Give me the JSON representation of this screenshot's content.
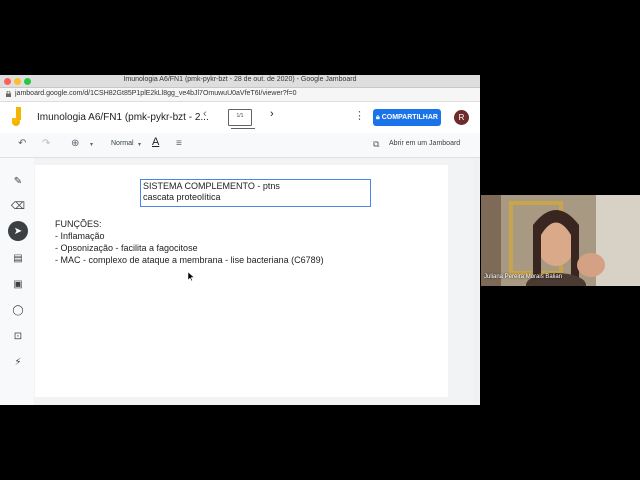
{
  "window": {
    "title": "Imunologia A6/FN1 (pmk-pykr-bzt - 28 de out. de 2020) - Google Jamboard",
    "url": "jamboard.google.com/d/1CSH82Gt85P1plE2kLl8gg_ve4bJl7OmuwuU0aVfeT6I/viewer?f=0"
  },
  "appbar": {
    "doc_title": "Imunologia A6/FN1 (pmk-pykr-bzt - 2...",
    "frame_indicator": "1/1",
    "share_label": "COMPARTILHAR",
    "avatar_initial": "R"
  },
  "toolbar": {
    "zoom_label": "Normal",
    "text_style_glyph": "A",
    "open_in_jamboard": "Abrir em um Jamboard"
  },
  "canvas": {
    "box_line1": "SISTEMA COMPLEMENTO - ptns",
    "box_line2": "cascata proteolítica",
    "lines": [
      "FUNÇÕES:",
      " - Inflamação",
      " - Opsonização - facilita a fagocitose",
      "- MAC - complexo de ataque a membrana - lise bacteriana (C6789)"
    ]
  },
  "video": {
    "participant_name": "Juliana Pereira Morais Balian"
  },
  "colors": {
    "share_button": "#1a73e8",
    "box_border": "#4a86e8",
    "jamboard_yellow": "#f4b400"
  }
}
